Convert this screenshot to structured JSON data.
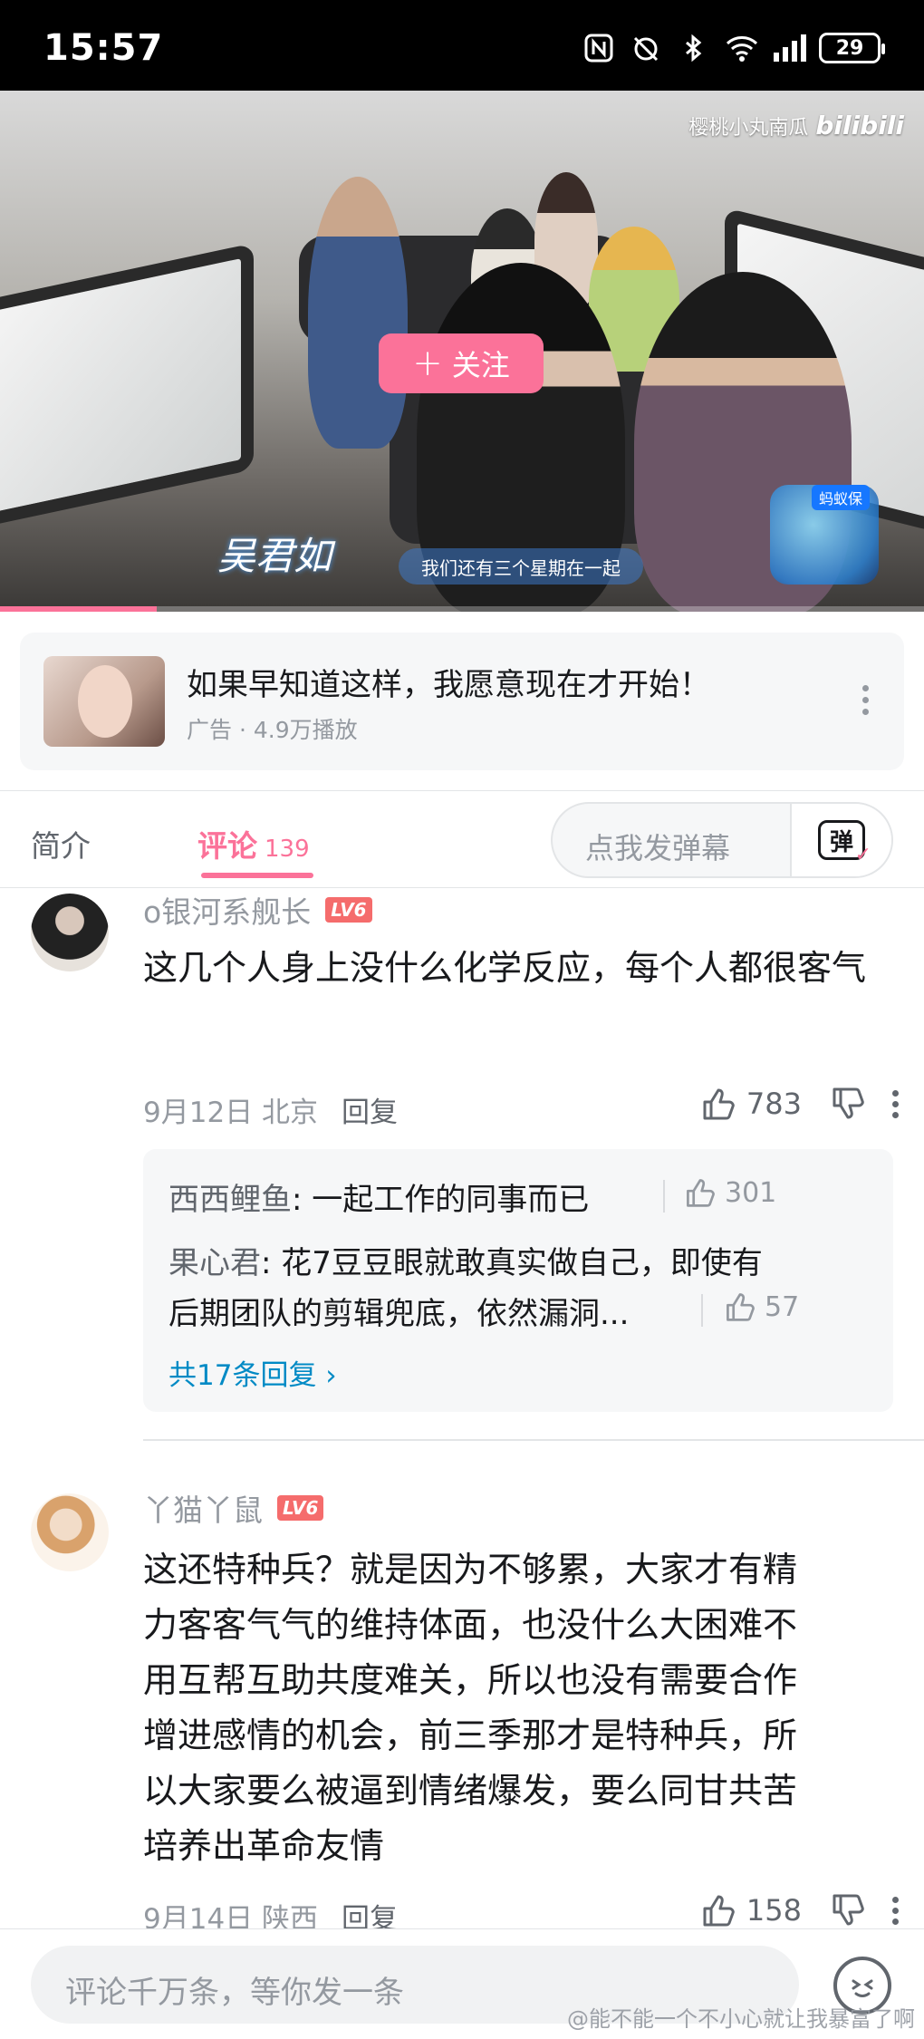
{
  "status_bar": {
    "time": "15:57",
    "battery": "29"
  },
  "video": {
    "watermark_user": "樱桃小丸南瓜",
    "watermark_logo": "bilibili",
    "follow_label": "关注",
    "name_caption": "吴君如",
    "subtitle": "我们还有三个星期在一起",
    "sponsor_badge": "蚂蚁保",
    "progress": 0.17,
    "accent_color": "#fb7299"
  },
  "ad": {
    "title": "如果早知道这样，我愿意现在才开始！",
    "meta": "广告 · 4.9万播放"
  },
  "tabs": {
    "intro": "简介",
    "comments": "评论",
    "comments_count": "139",
    "danmaku_placeholder": "点我发弹幕",
    "danmaku_icon_text": "弹"
  },
  "comments": [
    {
      "user": "o银河系舰长",
      "level": "LV6",
      "text": "这几个人身上没什么化学反应，每个人都很客气",
      "date": "9月12日",
      "location": "北京",
      "reply_label": "回复",
      "likes": "783",
      "replies": [
        {
          "name": "西西鲤鱼",
          "text": ": 一起工作的同事而已",
          "likes": "301"
        },
        {
          "name": "果心君",
          "text": ": 花7豆豆眼就敢真实做自己，即使有",
          "text2": "后期团队的剪辑兜底，依然漏洞...",
          "likes": "57"
        }
      ],
      "more_replies": "共17条回复 ›"
    },
    {
      "user": "丫猫丫鼠",
      "level": "LV6",
      "lines": [
        "这还特种兵？就是因为不够累，大家才有精",
        "力客客气气的维持体面，也没什么大困难不",
        "用互帮互助共度难关，所以也没有需要合作",
        "增进感情的机会，前三季那才是特种兵，所",
        "以大家要么被逼到情绪爆发，要么同甘共苦",
        "培养出革命友情"
      ],
      "date": "9月14日",
      "location": "陕西",
      "reply_label": "回复",
      "likes": "158"
    }
  ],
  "bottom": {
    "input_placeholder": "评论千万条，等你发一条",
    "weibo_watermark": "@能不能一个不小心就让我暴富了啊"
  }
}
